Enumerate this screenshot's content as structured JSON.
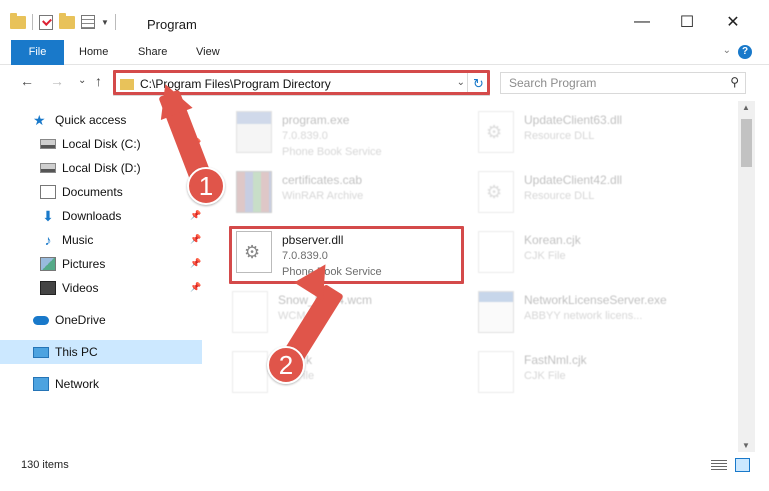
{
  "window": {
    "title": "Program",
    "controls": {
      "minimize": "—",
      "maximize": "☐",
      "close": "✕"
    }
  },
  "ribbon": {
    "tabs": [
      "File",
      "Home",
      "Share",
      "View"
    ],
    "help": "?"
  },
  "nav": {
    "back": "←",
    "forward": "→",
    "recent": "⌄",
    "up": "↑"
  },
  "address": {
    "path": "C:\\Program Files\\Program Directory",
    "dropdown": "⌄",
    "refresh": "↻"
  },
  "search": {
    "placeholder": "Search Program",
    "icon": "⚲"
  },
  "sidebar": {
    "items": [
      {
        "label": "Quick access",
        "icon": "star-icon"
      },
      {
        "label": "Local Disk (C:)",
        "icon": "drive-icon"
      },
      {
        "label": "Local Disk (D:)",
        "icon": "drive-icon"
      },
      {
        "label": "Documents",
        "icon": "documents-icon"
      },
      {
        "label": "Downloads",
        "icon": "download-icon"
      },
      {
        "label": "Music",
        "icon": "music-icon"
      },
      {
        "label": "Pictures",
        "icon": "pictures-icon"
      },
      {
        "label": "Videos",
        "icon": "videos-icon"
      },
      {
        "label": "OneDrive",
        "icon": "cloud-icon"
      },
      {
        "label": "This PC",
        "icon": "computer-icon",
        "selected": true
      },
      {
        "label": "Network",
        "icon": "network-icon"
      }
    ]
  },
  "files": [
    {
      "name": "program.exe",
      "meta1": "7.0.839.0",
      "meta2": "Phone Book Service",
      "icon": "exe-icon"
    },
    {
      "name": "UpdateClient63.dll",
      "meta1": "Resource DLL",
      "meta2": "",
      "icon": "dll-icon"
    },
    {
      "name": "certificates.cab",
      "meta1": "WinRAR Archive",
      "meta2": "",
      "icon": "archive-icon"
    },
    {
      "name": "UpdateClient42.dll",
      "meta1": "Resource DLL",
      "meta2": "",
      "icon": "dll-icon"
    },
    {
      "name": "pbserver.dll",
      "meta1": "7.0.839.0",
      "meta2": "Phone Book Service",
      "icon": "dll-icon"
    },
    {
      "name": "Korean.cjk",
      "meta1": "CJK File",
      "meta2": "",
      "icon": "file-icon"
    },
    {
      "name": "Snow_BP14.wcm",
      "meta1": "WCM File",
      "meta2": "",
      "icon": "file-icon"
    },
    {
      "name": "NetworkLicenseServer.exe",
      "meta1": "ABBYY network licens...",
      "meta2": "",
      "icon": "app-icon"
    },
    {
      "name": "Roll.rk",
      "meta1": "RK File",
      "meta2": "",
      "icon": "file-icon"
    },
    {
      "name": "FastNml.cjk",
      "meta1": "CJK File",
      "meta2": "",
      "icon": "file-icon"
    }
  ],
  "status": {
    "count": "130 items"
  },
  "callouts": {
    "one": "1",
    "two": "2"
  },
  "colors": {
    "accent": "#1979ca",
    "highlight": "#d44a4a",
    "callout": "#e0554a",
    "selected": "#cce8ff"
  }
}
